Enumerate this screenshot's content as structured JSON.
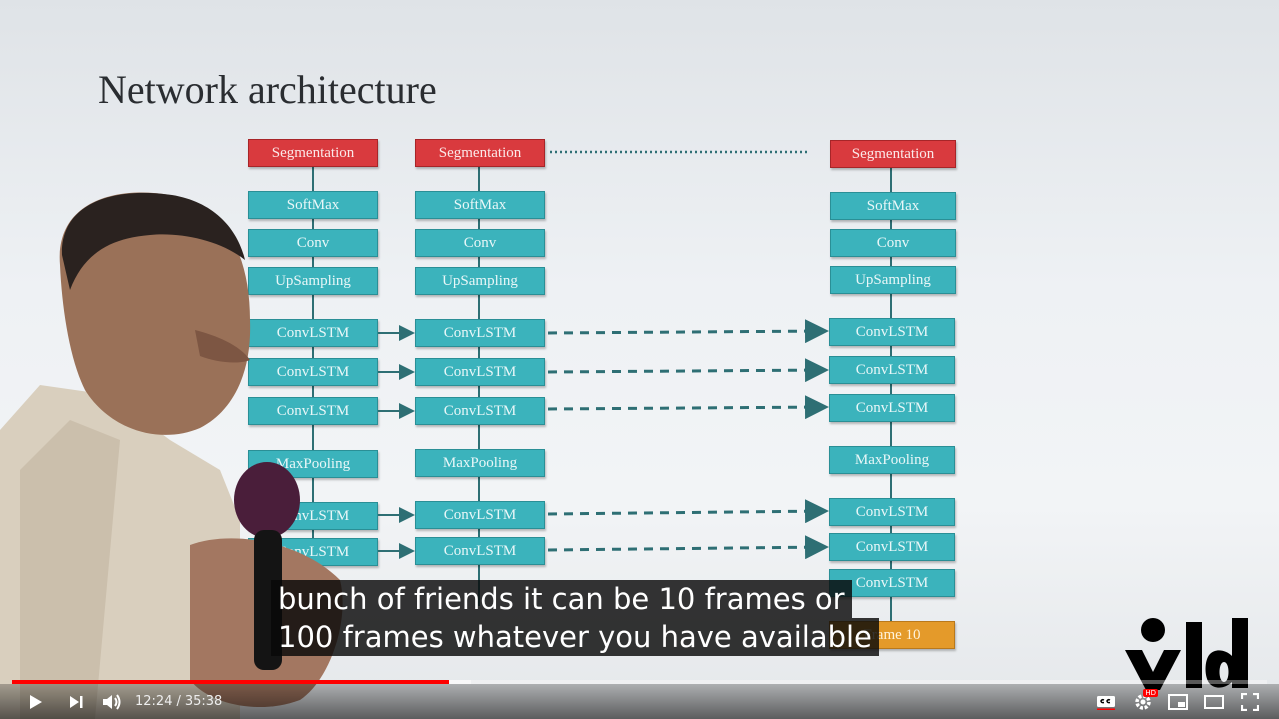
{
  "slide": {
    "title": "Network architecture",
    "columns": [
      {
        "labels": [
          "Segmentation",
          "SoftMax",
          "Conv",
          "UpSampling",
          "ConvLSTM",
          "ConvLSTM",
          "ConvLSTM",
          "MaxPooling",
          "ConvLSTM",
          "ConvLSTM"
        ]
      },
      {
        "labels": [
          "Segmentation",
          "SoftMax",
          "Conv",
          "UpSampling",
          "ConvLSTM",
          "ConvLSTM",
          "ConvLSTM",
          "MaxPooling",
          "ConvLSTM",
          "ConvLSTM"
        ]
      },
      {
        "labels": [
          "Segmentation",
          "SoftMax",
          "Conv",
          "UpSampling",
          "ConvLSTM",
          "ConvLSTM",
          "ConvLSTM",
          "MaxPooling",
          "ConvLSTM",
          "ConvLSTM",
          "ConvLSTM",
          "Frame 10"
        ]
      }
    ]
  },
  "captions": {
    "line1": "bunch of friends it can be 10 frames or",
    "line2": "100 frames whatever you have available"
  },
  "logo": {
    "text": "yld"
  },
  "player": {
    "current_time": "12:24",
    "separator": "/",
    "duration": "35:38",
    "played_fraction": 0.348,
    "buffered_fraction": 0.366,
    "icons": {
      "play": "play-icon",
      "next": "next-icon",
      "volume": "volume-icon",
      "subtitles": "cc-icon",
      "settings": "gear-icon",
      "miniplayer": "miniplayer-icon",
      "theater": "theater-icon",
      "fullscreen": "fullscreen-icon"
    },
    "settings_badge": "HD",
    "colors": {
      "progress": "#ff0000",
      "segmentation": "#d93a3e",
      "layer": "#3bb3bc",
      "frame": "#e49a2a"
    }
  }
}
